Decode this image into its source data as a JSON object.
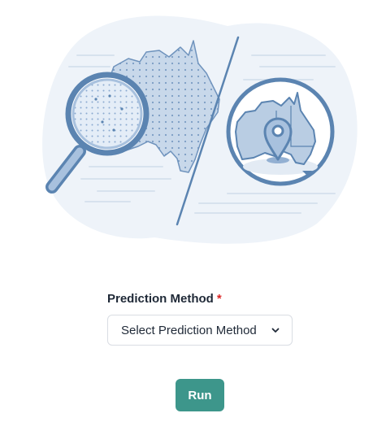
{
  "form": {
    "prediction_method_label": "Prediction Method",
    "required_marker": "*",
    "prediction_method_select": {
      "selected_value": "Select Prediction Method"
    }
  },
  "actions": {
    "run_label": "Run"
  },
  "illustration": {
    "left_icon": "magnifier-over-australia-map",
    "right_icon": "australia-map-with-location-pin"
  },
  "colors": {
    "accent": "#3d968b",
    "illustration_blue": "#5b84b1",
    "illustration_fill": "#b9cde3",
    "illustration_bg": "#eef3f9",
    "required": "#dc2626"
  }
}
